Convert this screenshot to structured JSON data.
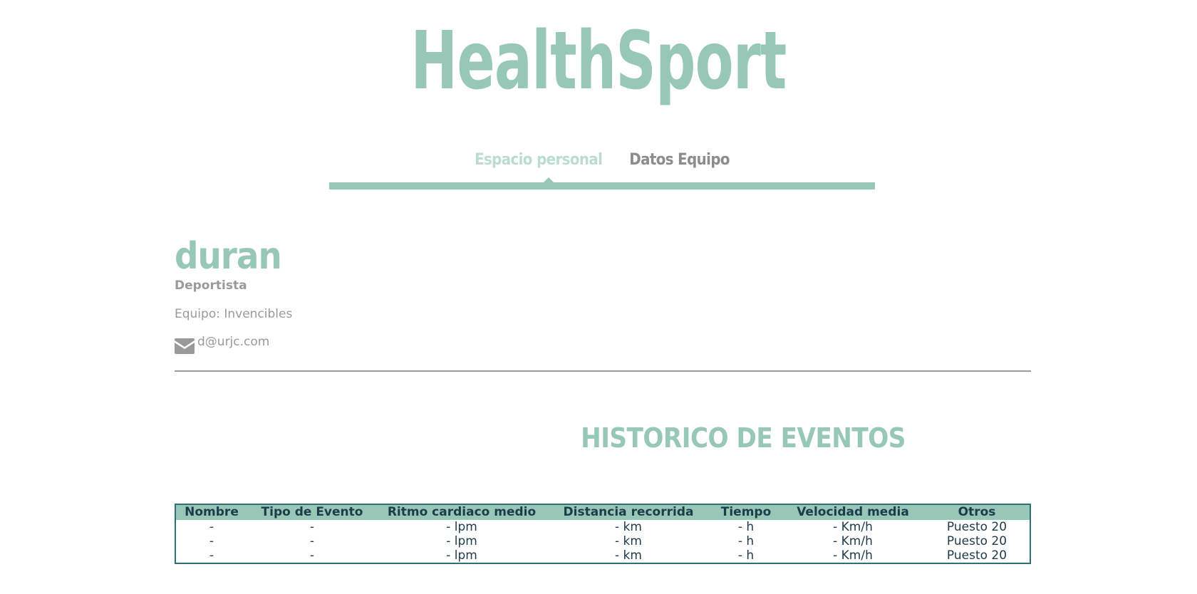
{
  "app": {
    "logo_text": "HealthSport"
  },
  "nav": {
    "items": [
      {
        "label": "Espacio personal",
        "active": true
      },
      {
        "label": "Datos Equipo",
        "active": false
      }
    ]
  },
  "profile": {
    "name": "duran",
    "role": "Deportista",
    "team": "Equipo: Invencibles",
    "email": "d@urjc.com"
  },
  "events": {
    "title": "HISTORICO DE EVENTOS",
    "columns": [
      "Nombre",
      "Tipo de Evento",
      "Ritmo cardiaco medio",
      "Distancia recorrida",
      "Tiempo",
      "Velocidad media",
      "Otros"
    ],
    "rows": [
      [
        "-",
        "-",
        "- lpm",
        "- km",
        "- h",
        "- Km/h",
        "Puesto 20"
      ],
      [
        "-",
        "-",
        "- lpm",
        "- km",
        "- h",
        "- Km/h",
        "Puesto 20"
      ],
      [
        "-",
        "-",
        "- lpm",
        "- km",
        "- h",
        "- Km/h",
        "Puesto 20"
      ]
    ]
  },
  "colors": {
    "accent": "#97c7b6",
    "accent_light": "#bcdcd0",
    "muted_text": "#9a9a9a",
    "table_border": "#2f6f78",
    "table_text": "#1e3b4a"
  },
  "icons": {
    "email": "envelope-icon"
  }
}
